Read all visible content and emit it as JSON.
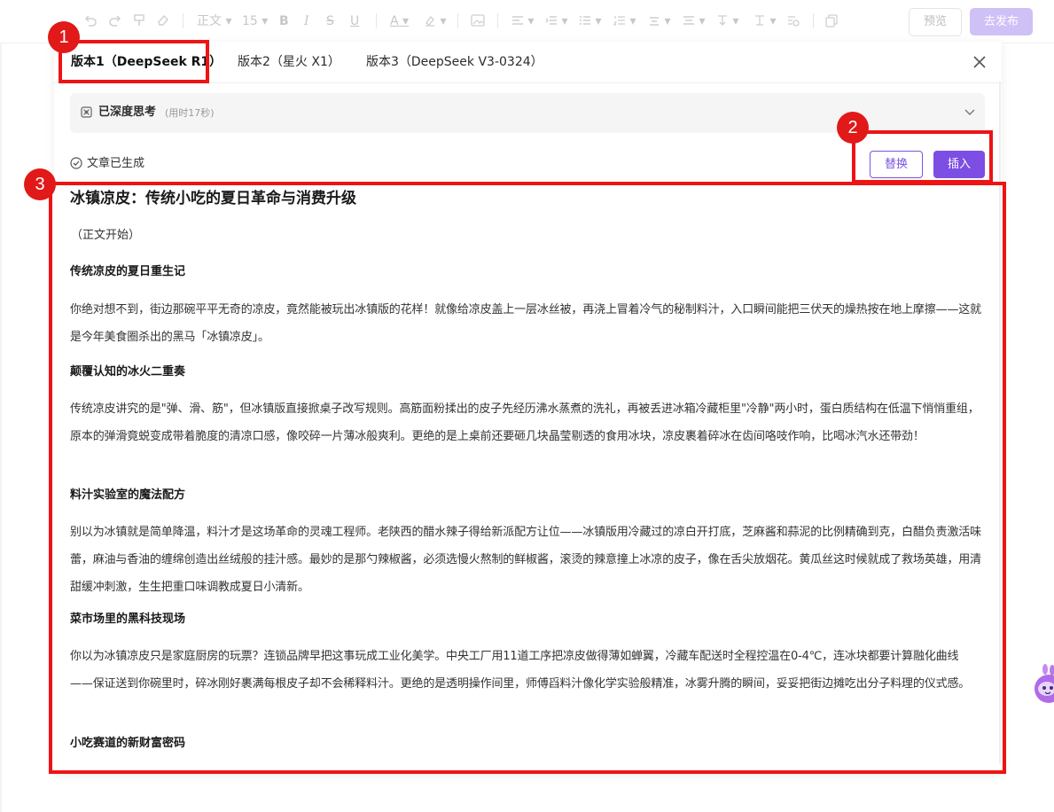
{
  "toolbar": {
    "font_label": "正文",
    "font_size": "15",
    "bold": "B",
    "italic": "I",
    "strike": "S",
    "underline": "U",
    "font_color": "A",
    "preview_label": "预览",
    "publish_label": "去发布"
  },
  "tabs": [
    {
      "label": "版本1（DeepSeek R1）",
      "active": true
    },
    {
      "label": "版本2（星火 X1）",
      "active": false
    },
    {
      "label": "版本3（DeepSeek V3-0324）",
      "active": false
    }
  ],
  "thinking": {
    "title": "已深度思考",
    "duration": "(用时17秒)"
  },
  "status": "文章已生成",
  "actions": {
    "replace_label": "替换",
    "insert_label": "插入"
  },
  "article": {
    "title": "冰镇凉皮：传统小吃的夏日革命与消费升级",
    "opening": "（正文开始）",
    "sections": [
      {
        "heading": "传统凉皮的夏日重生记",
        "body": "你绝对想不到，街边那碗平平无奇的凉皮，竟然能被玩出冰镇版的花样！就像给凉皮盖上一层冰丝被，再浇上冒着冷气的秘制料汁，入口瞬间能把三伏天的燥热按在地上摩擦——这就是今年美食圈杀出的黑马「冰镇凉皮」。"
      },
      {
        "heading": "颠覆认知的冰火二重奏",
        "body": "传统凉皮讲究的是\"弹、滑、筋\"，但冰镇版直接掀桌子改写规则。高筋面粉揉出的皮子先经历沸水蒸煮的洗礼，再被丢进冰箱冷藏柜里\"冷静\"两小时，蛋白质结构在低温下悄悄重组，原本的弹滑竟蜕变成带着脆度的清凉口感，像咬碎一片薄冰般爽利。更绝的是上桌前还要砸几块晶莹剔透的食用冰块，凉皮裹着碎冰在齿间咯吱作响，比喝冰汽水还带劲！"
      },
      {
        "heading": "料汁实验室的魔法配方",
        "body": "别以为冰镇就是简单降温，料汁才是这场革命的灵魂工程师。老陕西的醋水辣子得给新派配方让位——冰镇版用冷藏过的凉白开打底，芝麻酱和蒜泥的比例精确到克，白醋负责激活味蕾，麻油与香油的缠绵创造出丝绒般的挂汁感。最妙的是那勺辣椒酱，必须选慢火熬制的鲜椒酱，滚烫的辣意撞上冰凉的皮子，像在舌尖放烟花。黄瓜丝这时候就成了救场英雄，用清甜缓冲刺激，生生把重口味调教成夏日小清新。"
      },
      {
        "heading": "菜市场里的黑科技现场",
        "body": "你以为冰镇凉皮只是家庭厨房的玩票？连锁品牌早把这事玩成工业化美学。中央工厂用11道工序把凉皮做得薄如蝉翼，冷藏车配送时全程控温在0-4℃，连冰块都要计算融化曲线——保证送到你碗里时，碎冰刚好裹满每根皮子却不会稀释料汁。更绝的是透明操作间里，师傅舀料汁像化学实验般精准，冰雾升腾的瞬间，妥妥把街边摊吃出分子料理的仪式感。"
      },
      {
        "heading": "小吃赛道的新财富密码",
        "body": ""
      }
    ]
  },
  "annotations": [
    "1",
    "2",
    "3"
  ],
  "colors": {
    "accent": "#7c4ee4",
    "publish_disabled": "#cfc0f6",
    "annotation_red": "#ee1414"
  }
}
